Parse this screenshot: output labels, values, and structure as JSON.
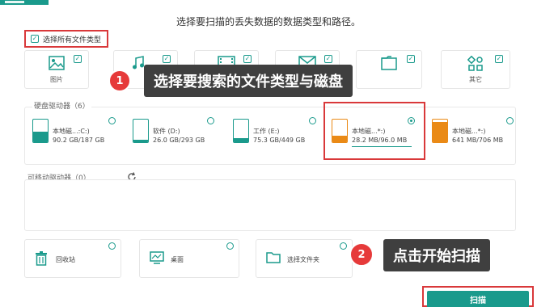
{
  "heading": "选择要扫描的丢失数据的数据类型和路径。",
  "select_all": {
    "label": "选择所有文件类型",
    "checked": true
  },
  "file_types": [
    {
      "label": "图片",
      "icon": "image-icon",
      "checked": true
    },
    {
      "label": "",
      "icon": "audio-icon",
      "checked": true
    },
    {
      "label": "",
      "icon": "video-icon",
      "checked": true
    },
    {
      "label": "",
      "icon": "email-icon",
      "checked": true
    },
    {
      "label": "",
      "icon": "document-icon",
      "checked": true
    },
    {
      "label": "其它",
      "icon": "other-icon",
      "checked": true
    }
  ],
  "callouts": {
    "step1": {
      "num": "1",
      "text": "选择要搜索的文件类型与磁盘"
    },
    "step2": {
      "num": "2",
      "text": "点击开始扫描"
    }
  },
  "hard_drives": {
    "title": "硬盘驱动器（6）",
    "items": [
      {
        "name": "本地磁...:C:)",
        "size": "90.2 GB/187 GB",
        "used_fraction": 0.48,
        "color": "#1a9a8c",
        "selected": false
      },
      {
        "name": "软件 (D:)",
        "size": "26.0 GB/293 GB",
        "used_fraction": 0.09,
        "color": "#1a9a8c",
        "selected": false
      },
      {
        "name": "工作 (E:)",
        "size": "75.3 GB/449 GB",
        "used_fraction": 0.17,
        "color": "#1a9a8c",
        "selected": false
      },
      {
        "name": "本地磁...*:)",
        "size": "28.2 MB/96.0 MB",
        "used_fraction": 0.29,
        "color": "#ea8a16",
        "selected": true
      },
      {
        "name": "本地磁...*:)",
        "size": "641 MB/706 MB",
        "used_fraction": 0.91,
        "color": "#ea8a16",
        "selected": false
      }
    ]
  },
  "removable": {
    "title": "可移动驱动器（0）",
    "refresh_icon": "refresh-icon"
  },
  "locations": [
    {
      "label": "回收站",
      "icon": "trash-icon"
    },
    {
      "label": "桌面",
      "icon": "desktop-icon"
    },
    {
      "label": "选择文件夹",
      "icon": "folder-icon"
    }
  ],
  "scan_button": "扫描"
}
